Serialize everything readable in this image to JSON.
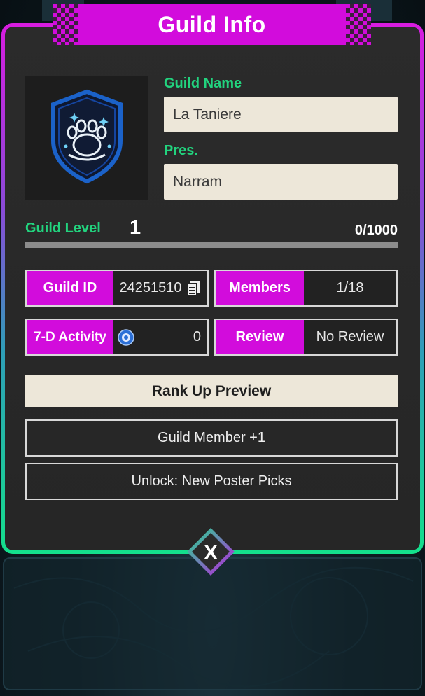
{
  "dialog": {
    "title": "Guild Info"
  },
  "guild": {
    "name_label": "Guild Name",
    "name_value": "La Taniere",
    "president_label": "Pres.",
    "president_value": "Narram",
    "emblem_icon": "paw-shield-icon"
  },
  "level": {
    "label": "Guild Level",
    "value": "1",
    "progress_text": "0/1000",
    "progress_fraction": 0
  },
  "stats": {
    "guild_id_label": "Guild ID",
    "guild_id_value": "24251510",
    "copy_icon": "copy-icon",
    "members_label": "Members",
    "members_value": "1/18",
    "activity_label": "7-D Activity",
    "activity_icon": "activity-token-icon",
    "activity_value": "0",
    "review_label": "Review",
    "review_value": "No Review"
  },
  "rank_up": {
    "button_label": "Rank Up Preview",
    "perks": [
      "Guild Member +1",
      "Unlock: New Poster Picks"
    ]
  },
  "close": {
    "label": "X",
    "icon": "close-icon"
  },
  "colors": {
    "accent_magenta": "#d20cdc",
    "accent_green": "#22d37e",
    "panel_bg": "#2b2b2b",
    "field_bg": "#ede7d9"
  }
}
